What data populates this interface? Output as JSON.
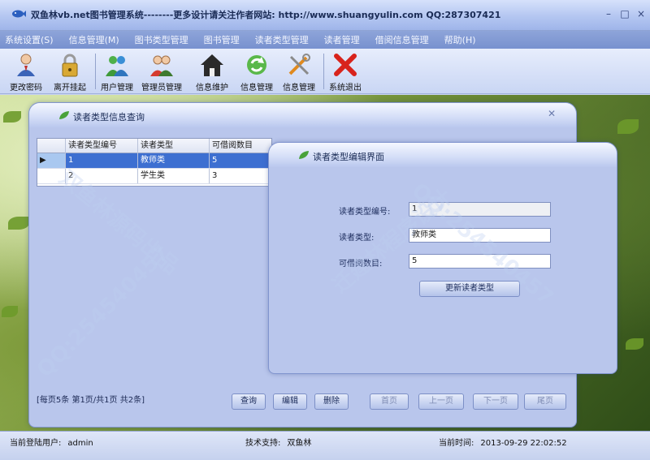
{
  "app": {
    "title": "双鱼林vb.net图书管理系统--------更多设计请关注作者网站:   http://www.shuangyulin.com QQ:287307421"
  },
  "window_controls": {
    "minimize": "–",
    "maximize": "□",
    "close": "×"
  },
  "menu": [
    "系统设置(S)",
    "信息管理(M)",
    "图书类型管理",
    "图书管理",
    "读者类型管理",
    "读者管理",
    "借阅信息管理",
    "帮助(H)"
  ],
  "toolbar": [
    {
      "label": "更改密码",
      "icon": "user-key-icon"
    },
    {
      "label": "离开挂起",
      "icon": "padlock-icon"
    },
    {
      "label": "用户管理",
      "icon": "users-icon"
    },
    {
      "label": "管理员管理",
      "icon": "admins-icon"
    },
    {
      "label": "信息维护",
      "icon": "house-icon"
    },
    {
      "label": "信息管理",
      "icon": "recycle-icon"
    },
    {
      "label": "信息管理",
      "icon": "tools-icon"
    },
    {
      "label": "系统退出",
      "icon": "exit-cross-icon"
    }
  ],
  "query_window": {
    "title": "读者类型信息查询",
    "columns": [
      "读者类型编号",
      "读者类型",
      "可借阅数目"
    ],
    "rows": [
      {
        "id": "1",
        "type": "教师类",
        "count": "5",
        "selected": true
      },
      {
        "id": "2",
        "type": "学生类",
        "count": "3",
        "selected": false
      }
    ],
    "pager_text": "[每页5条  第1页/共1页    共2条]",
    "buttons": {
      "query": "查询",
      "edit": "编辑",
      "delete": "删除",
      "first": "首页",
      "prev": "上一页",
      "next": "下一页",
      "last": "尾页"
    }
  },
  "edit_window": {
    "title": "读者类型编辑界面",
    "fields": {
      "id_label": "读者类型编号:",
      "id_value": "1",
      "type_label": "读者类型:",
      "type_value": "教师类",
      "count_label": "可借阅数目:",
      "count_value": "5"
    },
    "update_button": "更新读者类型"
  },
  "statusbar": {
    "user_label": "当前登陆用户:",
    "user_value": "admin",
    "support_label": "技术支持:",
    "support_value": "双鱼林",
    "time_label": "当前时间:",
    "time_value": "2013-09-29 22:02:52"
  },
  "watermarks": [
    "QQ:254540457",
    "双鱼林源码出品",
    "迁建林程序设计"
  ]
}
